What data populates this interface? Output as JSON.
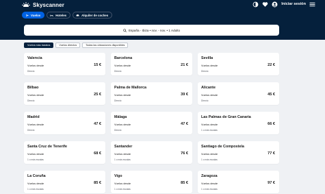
{
  "header": {
    "brand": "Skyscanner",
    "login_label": "Iniciar sesión",
    "icons": [
      "theme-toggle-icon",
      "heart-icon",
      "user-icon",
      "menu-icon"
    ]
  },
  "tabs": [
    {
      "label": "Vuelos",
      "icon": "plane-icon",
      "active": true
    },
    {
      "label": "Hoteles",
      "icon": "bed-icon",
      "active": false
    },
    {
      "label": "Alquiler de coches",
      "icon": "car-icon",
      "active": false
    }
  ],
  "search": {
    "summary": "España - Ibiza • nov. - nov. • 1 Adulto"
  },
  "filters": [
    {
      "label": "Vuelos más baratos",
      "active": true
    },
    {
      "label": "Vuelos directos",
      "active": false
    },
    {
      "label": "Todas las ubicaciones disponibles",
      "active": false
    }
  ],
  "results": [
    {
      "destination": "Valencia",
      "from_label": "Vuelos desde",
      "price": "15 €",
      "stops": "Directo"
    },
    {
      "destination": "Barcelona",
      "from_label": "Vuelos desde",
      "price": "21 €",
      "stops": "Directo"
    },
    {
      "destination": "Sevilla",
      "from_label": "Vuelos desde",
      "price": "22 €",
      "stops": "Directo"
    },
    {
      "destination": "Bilbao",
      "from_label": "Vuelos desde",
      "price": "25 €",
      "stops": "Directo"
    },
    {
      "destination": "Palma de Mallorca",
      "from_label": "Vuelos desde",
      "price": "39 €",
      "stops": "Directo"
    },
    {
      "destination": "Alicante",
      "from_label": "Vuelos desde",
      "price": "45 €",
      "stops": "Directo"
    },
    {
      "destination": "Madrid",
      "from_label": "Vuelos desde",
      "price": "47 €",
      "stops": "Directo"
    },
    {
      "destination": "Málaga",
      "from_label": "Vuelos desde",
      "price": "47 €",
      "stops": "Directo"
    },
    {
      "destination": "Las Palmas de Gran Canaria",
      "from_label": "Vuelos desde",
      "price": "66 €",
      "stops": "1 o más escalas"
    },
    {
      "destination": "Santa Cruz de Tenerife",
      "from_label": "Vuelos desde",
      "price": "68 €",
      "stops": "1 o más escalas"
    },
    {
      "destination": "Santander",
      "from_label": "Vuelos desde",
      "price": "76 €",
      "stops": "1 o más escalas"
    },
    {
      "destination": "Santiago de Compostela",
      "from_label": "Vuelos desde",
      "price": "77 €",
      "stops": "1 o más escalas"
    },
    {
      "destination": "La Coruña",
      "from_label": "Vuelos desde",
      "price": "85 €",
      "stops": "1 o más escalas"
    },
    {
      "destination": "Vigo",
      "from_label": "Vuelos desde",
      "price": "85 €",
      "stops": "1 o más escalas"
    },
    {
      "destination": "Zaragoza",
      "from_label": "Vuelos desde",
      "price": "97 €",
      "stops": "1 o más escalas"
    }
  ],
  "colors": {
    "header_bg": "#05203c",
    "accent": "#0062e3",
    "page_bg": "#eff1f4"
  }
}
